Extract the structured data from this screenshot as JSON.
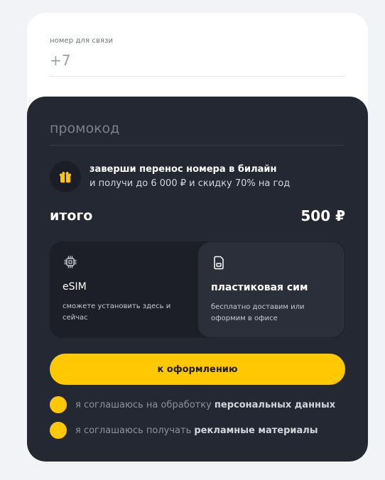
{
  "phone": {
    "label": "номер для связи",
    "placeholder": "+7"
  },
  "promo": {
    "placeholder": "промокод"
  },
  "banner": {
    "icon": "gift-icon",
    "title": "заверши перенос номера в билайн",
    "subtitle": "и получи до 6 000 ₽ и скидку 70% на год"
  },
  "total": {
    "label": "итого",
    "value": "500 ₽"
  },
  "sim_options": [
    {
      "icon": "chip-icon",
      "title": "eSIM",
      "description": "сможете установить здесь и сейчас",
      "selected": false
    },
    {
      "icon": "sim-card-icon",
      "title": "пластиковая сим",
      "description": "бесплатно доставим или оформим в офисе",
      "selected": true
    }
  ],
  "checkout": {
    "label": "к оформлению"
  },
  "consents": [
    {
      "text": "я соглашаюсь на обработку ",
      "link": "персональных данных"
    },
    {
      "text": "я соглашаюсь получать ",
      "link": "рекламные материалы"
    }
  ],
  "colors": {
    "accent": "#ffc800",
    "dark_panel": "#242833",
    "card": "#ffffff"
  }
}
